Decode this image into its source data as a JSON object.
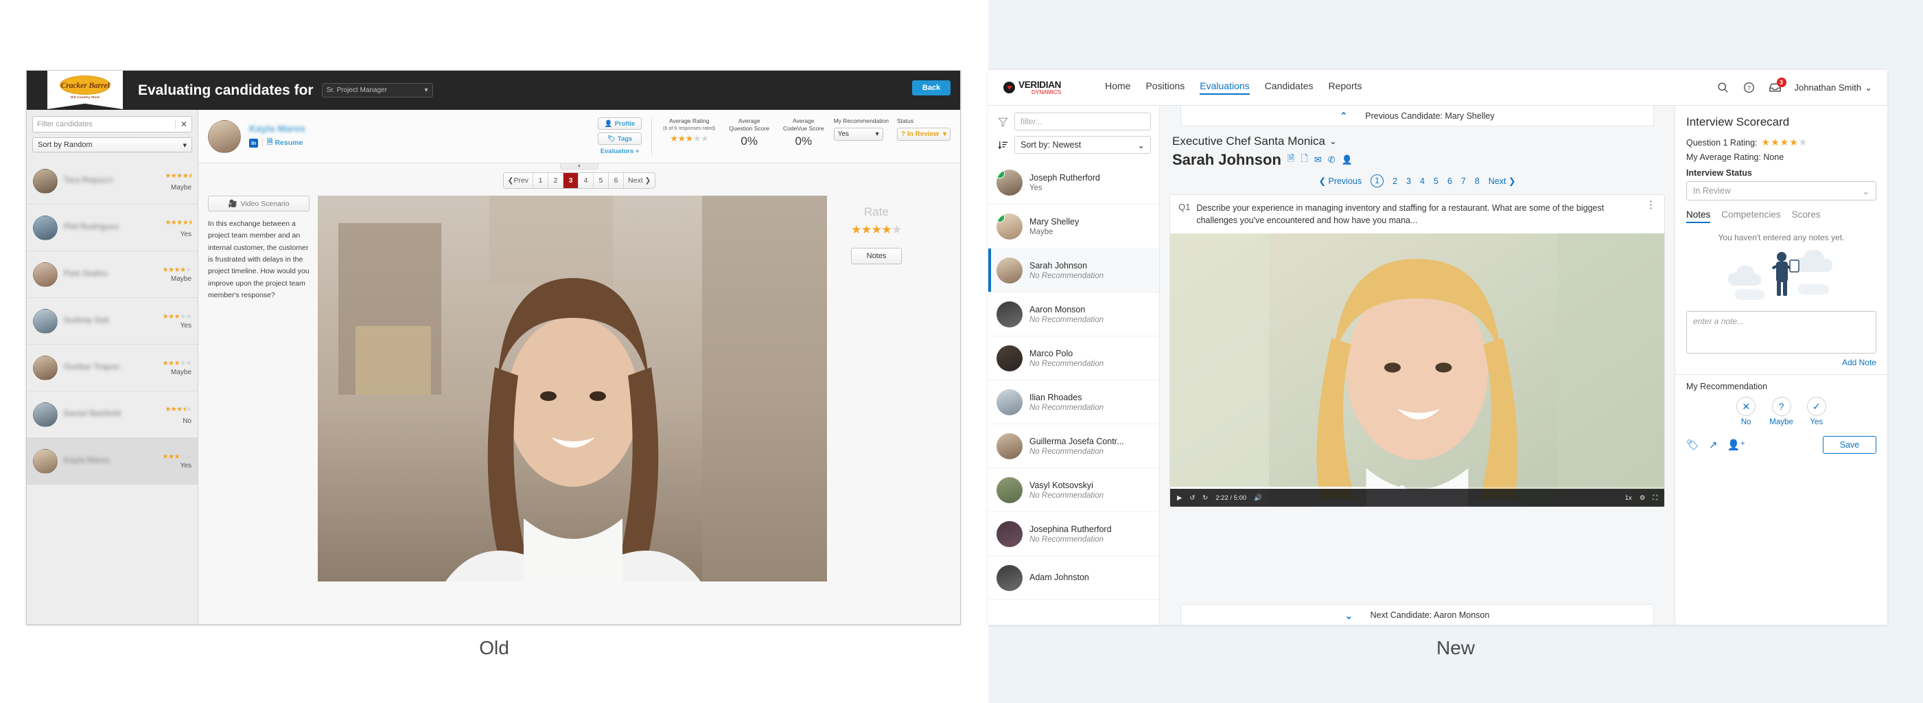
{
  "old": {
    "caption": "Old",
    "brand": {
      "name": "Cracker Barrel",
      "tagline": "Old Country Store"
    },
    "header": {
      "title": "Evaluating candidates for",
      "position": "Sr. Project Manager",
      "back_label": "Back"
    },
    "sidebar": {
      "filter_placeholder": "Filter candidates",
      "clear_label": "✕",
      "sort_label": "Sort by Random",
      "candidates": [
        {
          "name": "Tara Repucci",
          "stars": 4.5,
          "recommendation": "Maybe",
          "selected": false,
          "face": "f1"
        },
        {
          "name": "Phil Rodriguez",
          "stars": 4.5,
          "recommendation": "Yes",
          "selected": false,
          "face": "f2"
        },
        {
          "name": "Pam Seales",
          "stars": 4,
          "recommendation": "Maybe",
          "selected": false,
          "face": "f3"
        },
        {
          "name": "Sudeep Suk",
          "stars": 3,
          "recommendation": "Yes",
          "selected": false,
          "face": "f4"
        },
        {
          "name": "Gunkar Trapos",
          "stars": 3,
          "recommendation": "Maybe",
          "selected": false,
          "face": "f5"
        },
        {
          "name": "Daniel Banfield",
          "stars": 3.5,
          "recommendation": "No",
          "selected": false,
          "face": "f6"
        },
        {
          "name": "Kayla Mares",
          "stars": 3,
          "recommendation": "Yes",
          "selected": true,
          "face": "f7"
        }
      ]
    },
    "candidate_header": {
      "name": "Kayla Mares",
      "linkedin_label": "in",
      "resume_label": "Resume",
      "profile_label": "Profile",
      "tags_label": "Tags",
      "evaluators_label": "Evaluators +",
      "metrics": [
        {
          "label": "Average Rating",
          "sub": "(6 of 6 responses rated)",
          "type": "stars",
          "stars": 3
        },
        {
          "label": "Average\nQuestion Score",
          "sub": "",
          "type": "value",
          "value": "0%"
        },
        {
          "label": "Average\nCodeVue Score",
          "sub": "",
          "type": "value",
          "value": "0%"
        }
      ],
      "my_recommendation_label": "My Recommendation",
      "my_recommendation_value": "Yes",
      "status_label": "Status",
      "status_value": "? In Review"
    },
    "pagination": {
      "prev_label": "Prev",
      "next_label": "Next",
      "pages": [
        "1",
        "2",
        "3",
        "4",
        "5",
        "6"
      ],
      "active": "3"
    },
    "scenario": {
      "button_label": "Video Scenario",
      "text": "In this exchange between a project team member and an internal customer, the customer is frustrated with delays in the project timeline.  How would you improve upon the project team member's response?"
    },
    "rate": {
      "label": "Rate",
      "stars": 4,
      "notes_label": "Notes"
    }
  },
  "new": {
    "caption": "New",
    "brand": {
      "name": "VERIDIAN",
      "sub": "DYNAMICS"
    },
    "nav": [
      {
        "label": "Home",
        "active": false
      },
      {
        "label": "Positions",
        "active": false
      },
      {
        "label": "Evaluations",
        "active": true
      },
      {
        "label": "Candidates",
        "active": false
      },
      {
        "label": "Reports",
        "active": false
      }
    ],
    "top_right": {
      "search_icon": "search-icon",
      "help_icon": "help-icon",
      "inbox_icon": "inbox-icon",
      "inbox_badge": "3",
      "user_name": "Johnathan Smith"
    },
    "list": {
      "filter_placeholder": "filter...",
      "sort_label": "Sort by: Newest",
      "candidates": [
        {
          "name": "Joseph Rutherford",
          "recommendation": "Yes",
          "checked": true,
          "selected": false,
          "face": "f8"
        },
        {
          "name": "Mary Shelley",
          "recommendation": "Maybe",
          "checked": true,
          "selected": false,
          "face": "f9"
        },
        {
          "name": "Sarah Johnson",
          "recommendation": "No Recommendation",
          "checked": false,
          "selected": true,
          "face": "f7"
        },
        {
          "name": "Aaron Monson",
          "recommendation": "No Recommendation",
          "checked": false,
          "selected": false,
          "face": "f10"
        },
        {
          "name": "Marco Polo",
          "recommendation": "No Recommendation",
          "checked": false,
          "selected": false,
          "face": "f15"
        },
        {
          "name": "Ilian Rhoades",
          "recommendation": "No Recommendation",
          "checked": false,
          "selected": false,
          "face": "f11"
        },
        {
          "name": "Guillerma Josefa Contr...",
          "recommendation": "No Recommendation",
          "checked": false,
          "selected": false,
          "face": "f12"
        },
        {
          "name": "Vasyl Kotsovskyi",
          "recommendation": "No Recommendation",
          "checked": false,
          "selected": false,
          "face": "f13"
        },
        {
          "name": "Josephina Rutherford",
          "recommendation": "No Recommendation",
          "checked": false,
          "selected": false,
          "face": "f14"
        },
        {
          "name": "Adam Johnston",
          "recommendation": "",
          "checked": false,
          "selected": false,
          "face": "f10"
        }
      ]
    },
    "center": {
      "prev_candidate_label": "Previous Candidate: Mary Shelley",
      "next_candidate_label": "Next Candidate: Aaron Monson",
      "position": "Executive Chef Santa Monica",
      "candidate_name": "Sarah Johnson",
      "candidate_icons": [
        "resume-icon",
        "document-icon",
        "email-icon",
        "phone-icon",
        "profile-icon"
      ],
      "pagination": {
        "prev_label": "Previous",
        "next_label": "Next",
        "pages": [
          "1",
          "2",
          "3",
          "4",
          "5",
          "6",
          "7",
          "8"
        ],
        "active": "1"
      },
      "question": {
        "number": "Q1",
        "text": "Describe your experience in managing inventory and staffing for a restaurant. What are some of the biggest challenges you've encountered and how have you mana..."
      },
      "video": {
        "current_time": "2:22",
        "duration": "5:00",
        "speed": "1x"
      }
    },
    "scorecard": {
      "title": "Interview Scorecard",
      "question_rating_label": "Question 1 Rating:",
      "question_rating": 4,
      "average_rating_label": "My Average Rating: None",
      "status_label": "Interview Status",
      "status_value": "In Review",
      "tabs": [
        {
          "label": "Notes",
          "active": true
        },
        {
          "label": "Competencies",
          "active": false
        },
        {
          "label": "Scores",
          "active": false
        }
      ],
      "empty_text": "You haven't entered any notes yet.",
      "note_placeholder": "enter a note...",
      "add_note_label": "Add Note",
      "recommendation_label": "My Recommendation",
      "recommendation_options": [
        {
          "label": "No",
          "icon": "close-icon"
        },
        {
          "label": "Maybe",
          "icon": "question-icon"
        },
        {
          "label": "Yes",
          "icon": "check-icon"
        }
      ],
      "bottom_icons": [
        "tag-icon",
        "share-icon",
        "add-user-icon"
      ],
      "save_label": "Save"
    }
  },
  "colors": {
    "old_accent": "#a71515",
    "old_blue": "#2196d6",
    "star": "#f5a623",
    "new_accent": "#0b73c4",
    "badge_red": "#e02020",
    "check_green": "#1faa4b"
  }
}
